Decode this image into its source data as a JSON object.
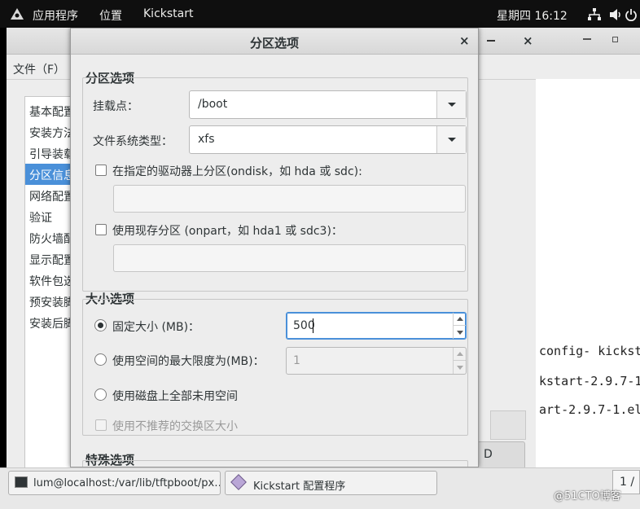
{
  "topbar": {
    "applications": "应用程序",
    "places": "位置",
    "active_app": "Kickstart",
    "clock": "星期四 16:12"
  },
  "main_window": {
    "menu_file": "文件（F）",
    "nav_items": [
      "基本配置",
      "安装方法",
      "引导装载",
      "分区信息",
      "网络配置",
      "验证",
      "防火墙配",
      "显示配置",
      "软件包选",
      "预安装脚",
      "安装后脚"
    ],
    "selected_nav": "分区信息",
    "bg_button_label": "D"
  },
  "terminal": {
    "lines": [
      "config- kicksta",
      "kstart-2.9.7-1",
      "art-2.9.7-1.el"
    ]
  },
  "dialog": {
    "title": "分区选项",
    "close": "×",
    "partition_section": {
      "title": "分区选项",
      "mount_point_label": "挂载点：",
      "mount_point_value": "/boot",
      "fs_type_label": "文件系统类型：",
      "fs_type_value": "xfs",
      "ondisk_label": "在指定的驱动器上分区(ondisk，如 hda 或 sdc):",
      "ondisk_value": "",
      "onpart_label": "使用现存分区 (onpart，如 hda1 或 sdc3)：",
      "onpart_value": ""
    },
    "size_section": {
      "title": "大小选项",
      "fixed_size_label": "固定大小 (MB)：",
      "fixed_size_value": "500",
      "max_size_label": "使用空间的最大限度为(MB)：",
      "max_size_value": "1",
      "fill_disk_label": "使用磁盘上全部未用空间",
      "recommended_swap_label": "使用不推荐的交换区大小"
    },
    "special_section": {
      "title": "特殊选项"
    }
  },
  "taskbar": {
    "terminal_task": "lum@localhost:/var/lib/tftpboot/px…",
    "kickstart_task": "Kickstart 配置程序",
    "pager": "1 /"
  },
  "watermark": "@51CTO博客"
}
